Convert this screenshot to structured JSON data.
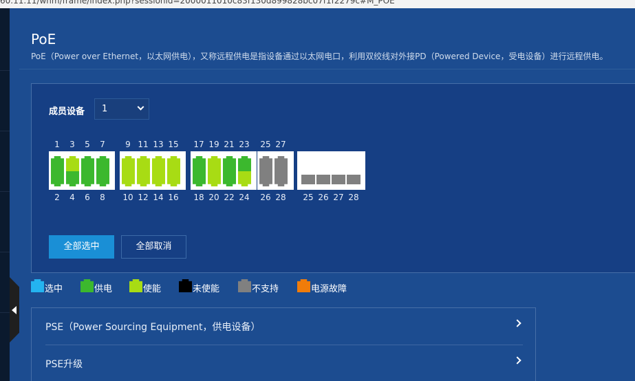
{
  "address_bar": {
    "url_fragment": "60.11.11/wnm/frame/index.php?sessionid=2000011010c83f130d899828bc07f1f2279c#M_POE"
  },
  "header": {
    "title": "PoE",
    "description": "PoE（Power over Ethernet，以太网供电），又称远程供电是指设备通过以太网电口，利用双绞线对外接PD（Powered Device，受电设备）进行远程供电。"
  },
  "member": {
    "label": "成员设备",
    "selected": "1"
  },
  "ports": {
    "top_numbers": [
      "1",
      "3",
      "5",
      "7",
      "9",
      "11",
      "13",
      "15",
      "17",
      "19",
      "21",
      "23",
      "25",
      "27"
    ],
    "bottom_numbers": [
      "2",
      "4",
      "6",
      "8",
      "10",
      "12",
      "14",
      "16",
      "18",
      "20",
      "22",
      "24",
      "26",
      "28"
    ],
    "sfp_numbers": [
      "25",
      "26",
      "27",
      "28"
    ],
    "top_status": [
      "powered",
      "enabled",
      "powered",
      "powered",
      "enabled",
      "enabled",
      "enabled",
      "enabled",
      "powered",
      "enabled",
      "powered",
      "powered",
      "unsupported",
      "unsupported"
    ],
    "bottom_status": [
      "powered",
      "powered",
      "powered",
      "powered",
      "enabled",
      "enabled",
      "enabled",
      "enabled",
      "powered",
      "enabled",
      "powered",
      "enabled",
      "unsupported",
      "unsupported"
    ],
    "sfp_status": [
      "unsupported",
      "unsupported",
      "unsupported",
      "unsupported"
    ]
  },
  "status_colors": {
    "selected": "#24b4f0",
    "powered": "#3cb82e",
    "enabled": "#a8dc14",
    "disabled": "#000000",
    "unsupported": "#808080",
    "fault": "#f07c0a"
  },
  "buttons": {
    "select_all": "全部选中",
    "deselect_all": "全部取消"
  },
  "legend": [
    {
      "key": "selected",
      "label": "选中"
    },
    {
      "key": "powered",
      "label": "供电"
    },
    {
      "key": "enabled",
      "label": "使能"
    },
    {
      "key": "disabled",
      "label": "未使能"
    },
    {
      "key": "unsupported",
      "label": "不支持"
    },
    {
      "key": "fault",
      "label": "电源故障"
    }
  ],
  "sections": [
    {
      "label": "PSE（Power Sourcing Equipment，供电设备）"
    },
    {
      "label": "PSE升级"
    }
  ]
}
